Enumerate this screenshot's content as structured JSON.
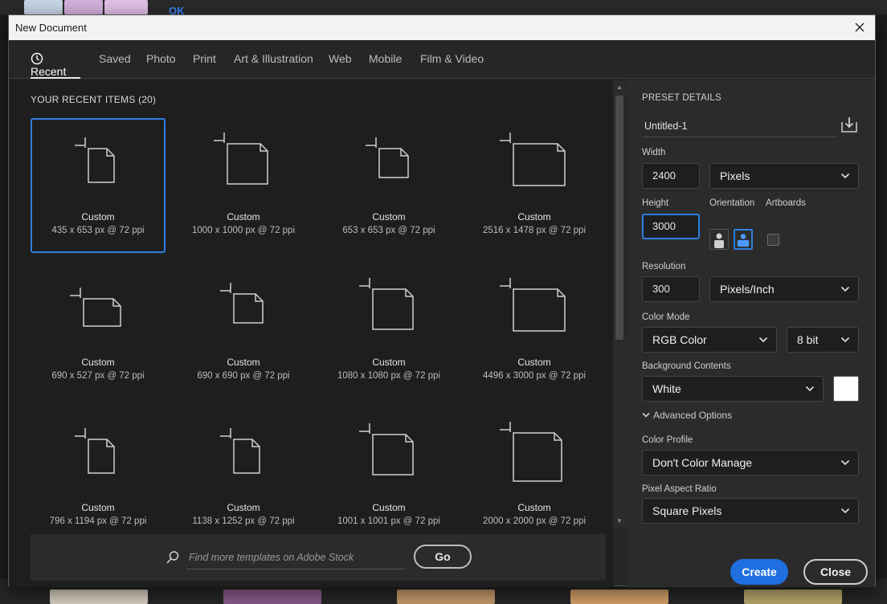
{
  "background": {
    "ok_label": "OK"
  },
  "dialog": {
    "title": "New Document"
  },
  "tabs": [
    {
      "label": "Recent",
      "active": true
    },
    {
      "label": "Saved"
    },
    {
      "label": "Photo"
    },
    {
      "label": "Print"
    },
    {
      "label": "Art & Illustration"
    },
    {
      "label": "Web"
    },
    {
      "label": "Mobile"
    },
    {
      "label": "Film & Video"
    }
  ],
  "recent": {
    "title": "YOUR RECENT ITEMS",
    "count": "(20)",
    "items": [
      {
        "label": "Custom",
        "dims": "435 x 653 px @ 72 ppi",
        "shape": "portrait",
        "selected": true
      },
      {
        "label": "Custom",
        "dims": "1000 x 1000 px @ 72 ppi",
        "shape": "square"
      },
      {
        "label": "Custom",
        "dims": "653 x 653 px @ 72 ppi",
        "shape": "square-small"
      },
      {
        "label": "Custom",
        "dims": "2516 x 1478 px @ 72 ppi",
        "shape": "landscape"
      },
      {
        "label": "Custom",
        "dims": "690 x 527 px @ 72 ppi",
        "shape": "landscape-small"
      },
      {
        "label": "Custom",
        "dims": "690 x 690 px @ 72 ppi",
        "shape": "square-small"
      },
      {
        "label": "Custom",
        "dims": "1080 x 1080 px @ 72 ppi",
        "shape": "square"
      },
      {
        "label": "Custom",
        "dims": "4496 x 3000 px @ 72 ppi",
        "shape": "landscape"
      },
      {
        "label": "Custom",
        "dims": "796 x 1194 px @ 72 ppi",
        "shape": "portrait"
      },
      {
        "label": "Custom",
        "dims": "1138 x 1252 px @ 72 ppi",
        "shape": "portrait"
      },
      {
        "label": "Custom",
        "dims": "1001 x 1001 px @ 72 ppi",
        "shape": "square"
      },
      {
        "label": "Custom",
        "dims": "2000 x 2000 px @ 72 ppi",
        "shape": "square-large"
      }
    ]
  },
  "search": {
    "placeholder": "Find more templates on Adobe Stock",
    "go_label": "Go"
  },
  "preset": {
    "title": "PRESET DETAILS",
    "name": "Untitled-1",
    "width_label": "Width",
    "width_value": "2400",
    "width_unit": "Pixels",
    "height_label": "Height",
    "height_value": "3000",
    "orientation_label": "Orientation",
    "artboards_label": "Artboards",
    "resolution_label": "Resolution",
    "resolution_value": "300",
    "resolution_unit": "Pixels/Inch",
    "color_mode_label": "Color Mode",
    "color_mode": "RGB Color",
    "bit_depth": "8 bit",
    "background_label": "Background Contents",
    "background": "White",
    "background_swatch": "#ffffff",
    "advanced_label": "Advanced Options",
    "color_profile_label": "Color Profile",
    "color_profile": "Don't Color Manage",
    "pixel_aspect_label": "Pixel Aspect Ratio",
    "pixel_aspect": "Square Pixels"
  },
  "buttons": {
    "create": "Create",
    "close": "Close"
  },
  "colors": {
    "accent": "#2f7fe0",
    "create": "#1f6fe0",
    "panel": "#2b2b2b",
    "pane": "#1e1e1e"
  }
}
